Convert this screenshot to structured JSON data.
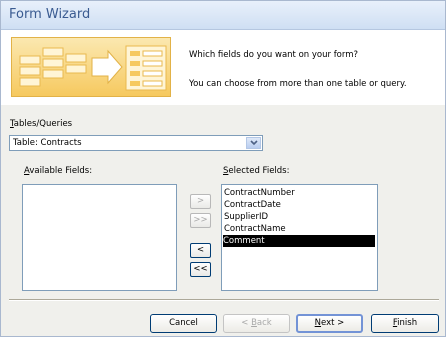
{
  "window": {
    "title": "Form Wizard"
  },
  "banner": {
    "question": "Which fields do you want on your form?",
    "hint": "You can choose from more than one table or query."
  },
  "tables_queries": {
    "label_accel": "T",
    "label_rest": "ables/Queries",
    "selected": "Table: Contracts"
  },
  "available": {
    "label_accel": "A",
    "label_rest": "vailable Fields:",
    "items": []
  },
  "selected_fields": {
    "label_accel": "S",
    "label_rest": "elected Fields:",
    "items": [
      "ContractNumber",
      "ContractDate",
      "SupplierID",
      "ContractName",
      "Comment"
    ],
    "highlighted_index": 4
  },
  "move_buttons": {
    "add_one": ">",
    "add_all": ">>",
    "remove_one": "<",
    "remove_all": "<<"
  },
  "footer": {
    "cancel": "Cancel",
    "back_pre": "< ",
    "back_accel": "B",
    "back_rest": "ack",
    "next_accel": "N",
    "next_rest": "ext >",
    "finish_accel": "F",
    "finish_rest": "inish"
  },
  "colors": {
    "title_text": "#3a5b91",
    "selection": "#000000"
  }
}
